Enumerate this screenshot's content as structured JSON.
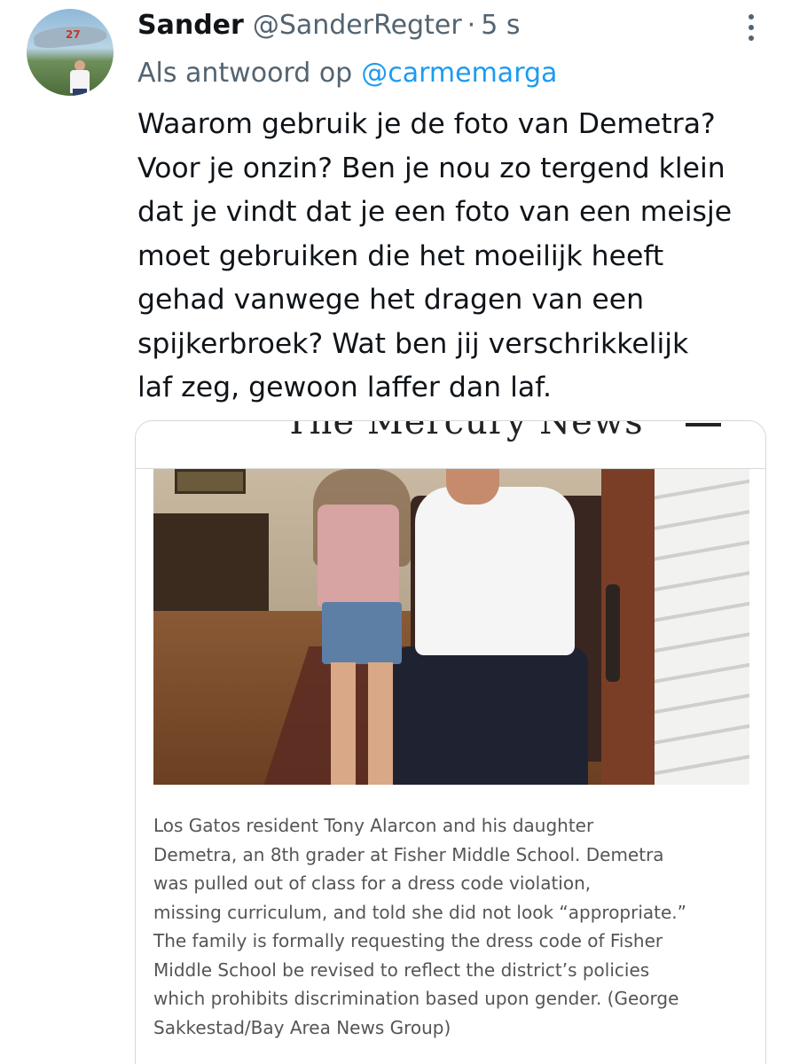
{
  "tweet": {
    "display_name": "Sander",
    "handle": "@SanderRegter",
    "separator": "·",
    "time": "5 s",
    "reply_prefix": "Als antwoord op",
    "reply_to": "@carmemarga",
    "text_lines": [
      "Waarom gebruik je de foto van Demetra?",
      "Voor je onzin? Ben je nou zo tergend klein",
      "dat je vindt dat je een foto van een meisje",
      "moet gebruiken die het moeilijk heeft",
      "gehad vanwege het dragen van een",
      "spijkerbroek? Wat ben jij verschrikkelijk",
      "laf zeg, gewoon laffer dan laf."
    ]
  },
  "avatar": {
    "badge_number": "27"
  },
  "card": {
    "masthead": "The Mercury News",
    "caption_lines": [
      "Los Gatos resident Tony Alarcon and his daughter",
      "Demetra, an 8th grader at Fisher Middle School. Demetra",
      "was pulled out of class for a dress code violation,",
      "missing curriculum, and told she did not look “appropriate.”",
      "The family is formally requesting the dress code of Fisher",
      "Middle School be revised to reflect the district’s policies",
      "which prohibits discrimination based upon gender. (George",
      "Sakkestad/Bay Area News Group)"
    ]
  },
  "icons": {
    "more": "more-vertical-icon"
  }
}
